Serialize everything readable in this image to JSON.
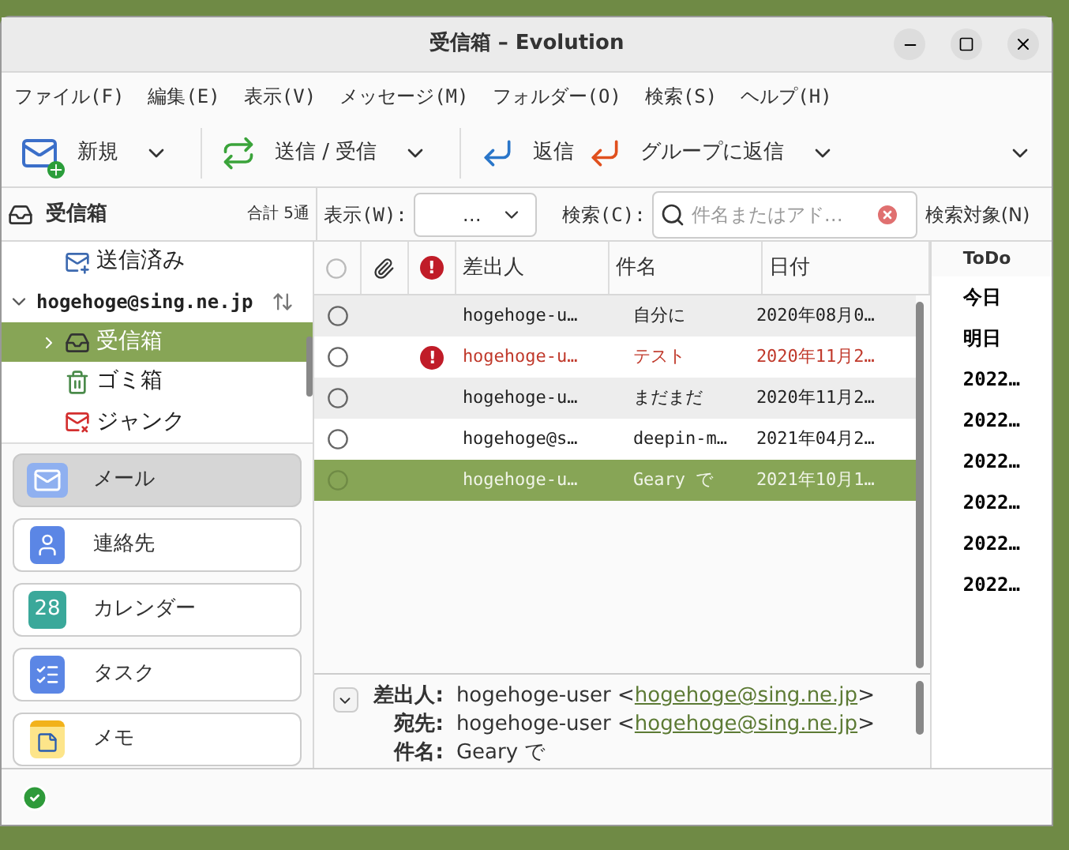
{
  "window": {
    "title": "受信箱 – Evolution"
  },
  "menu": [
    "ファイル(F)",
    "編集(E)",
    "表示(V)",
    "メッセージ(M)",
    "フォルダー(O)",
    "検索(S)",
    "ヘルプ(H)"
  ],
  "toolbar": [
    {
      "kind": "new",
      "label": "新規",
      "dropdown": true
    },
    {
      "kind": "send_receive",
      "label": "送信 / 受信",
      "dropdown": true
    },
    {
      "kind": "reply",
      "label": "返信",
      "dropdown": false
    },
    {
      "kind": "reply_group",
      "label": "グループに返信",
      "dropdown": true
    }
  ],
  "folder_header": {
    "title": "受信箱",
    "count": "合計 5通"
  },
  "filter": {
    "show_label": "表示(W):",
    "show_value": "…",
    "search_label": "検索(C):",
    "placeholder": "件名またはアド…",
    "scope_label": "検索対象(N)"
  },
  "folders": [
    {
      "kind": "sent",
      "label": "送信済み",
      "selected": false
    },
    {
      "kind": "account",
      "label": "hogehoge@sing.ne.jp",
      "expanded": true,
      "children": [
        {
          "kind": "inbox",
          "label": "受信箱",
          "selected": true,
          "expanded": false
        },
        {
          "kind": "trash",
          "label": "ゴミ箱",
          "selected": false
        },
        {
          "kind": "junk",
          "label": "ジャンク",
          "selected": false
        }
      ]
    }
  ],
  "switcher": [
    {
      "kind": "mail",
      "label": "メール",
      "selected": true
    },
    {
      "kind": "contacts",
      "label": "連絡先",
      "selected": false
    },
    {
      "kind": "calendar",
      "label": "カレンダー",
      "selected": false,
      "icon_text": "28"
    },
    {
      "kind": "tasks",
      "label": "タスク",
      "selected": false
    },
    {
      "kind": "memos",
      "label": "メモ",
      "selected": false
    }
  ],
  "table": {
    "important_mark": "!",
    "columns": [
      "差出人",
      "件名",
      "日付"
    ],
    "rows": [
      {
        "from": "hogehoge-u…",
        "subject": "自分に",
        "date": "2020年08月0…",
        "important": false,
        "selected": false
      },
      {
        "from": "hogehoge-u…",
        "subject": "テスト",
        "date": "2020年11月2…",
        "important": true,
        "selected": false
      },
      {
        "from": "hogehoge-u…",
        "subject": "まだまだ",
        "date": "2020年11月2…",
        "important": false,
        "selected": false
      },
      {
        "from": "hogehoge@s…",
        "subject": "deepin-m…",
        "date": "2021年04月2…",
        "important": false,
        "selected": false
      },
      {
        "from": "hogehoge-u…",
        "subject": "Geary で",
        "date": "2021年10月1…",
        "important": false,
        "selected": true
      }
    ]
  },
  "preview": {
    "expanded": false,
    "bracket_open": "<",
    "bracket_close": ">",
    "headers": [
      {
        "label": "差出人:",
        "name": "hogehoge-user",
        "email": "hogehoge@sing.ne.jp"
      },
      {
        "label": "宛先:",
        "name": "hogehoge-user",
        "email": "hogehoge@sing.ne.jp"
      },
      {
        "label": "件名:",
        "name": "Geary で"
      }
    ]
  },
  "todo": {
    "title": "ToDo",
    "items": [
      "今日",
      "明日",
      "2022…",
      "2022…",
      "2022…",
      "2022…",
      "2022…",
      "2022…"
    ]
  }
}
